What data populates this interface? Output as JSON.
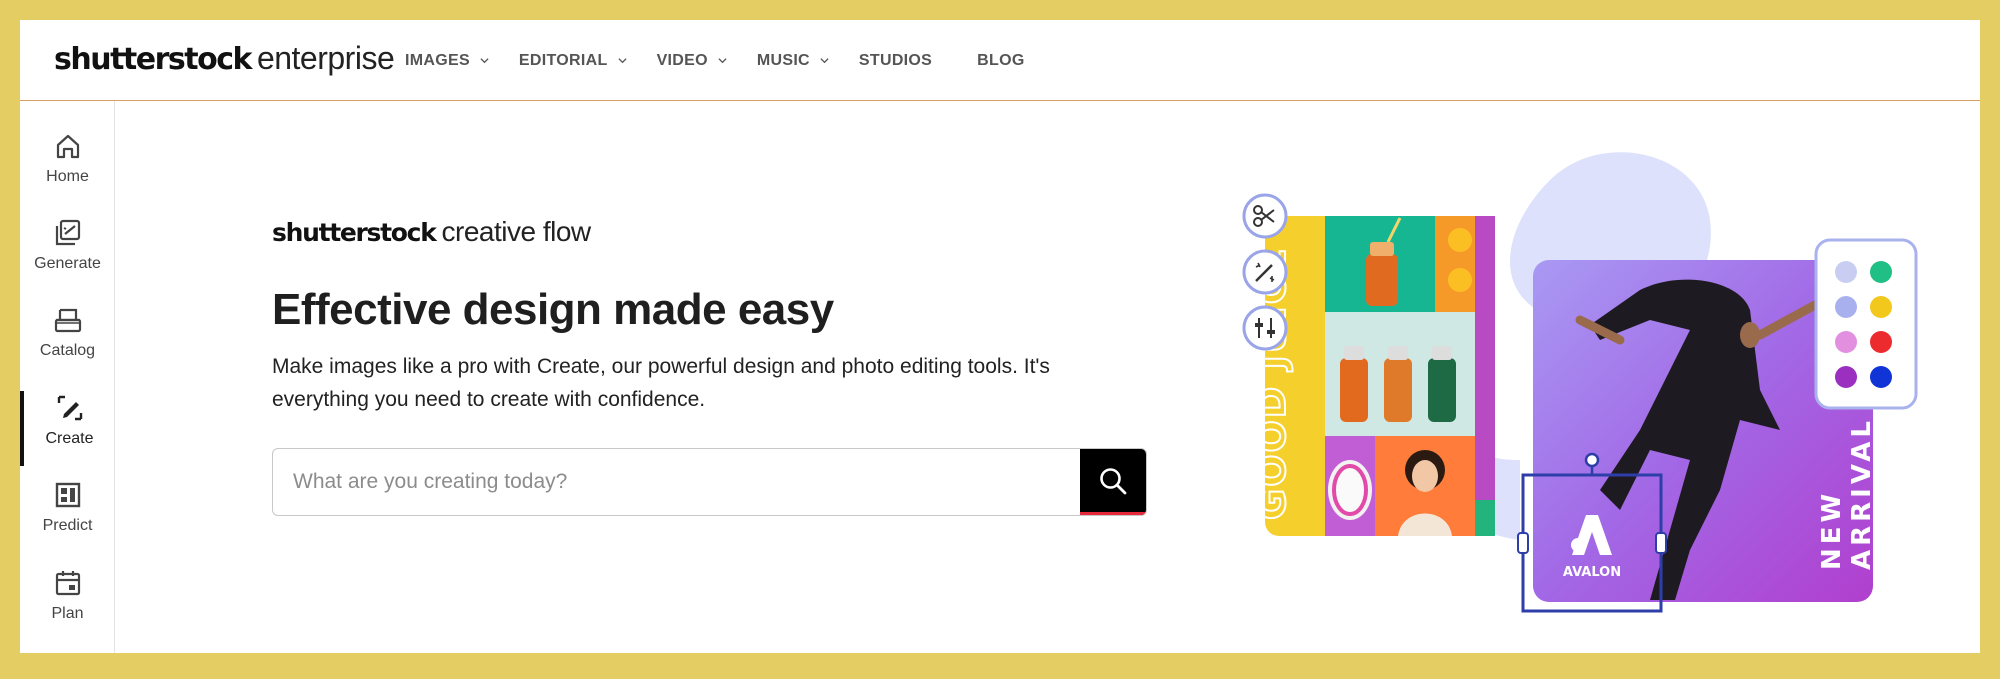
{
  "header": {
    "logo_brand": "shutterstock",
    "logo_suffix": "enterprise",
    "nav": [
      {
        "label": "IMAGES",
        "has_dropdown": true
      },
      {
        "label": "EDITORIAL",
        "has_dropdown": true
      },
      {
        "label": "VIDEO",
        "has_dropdown": true
      },
      {
        "label": "MUSIC",
        "has_dropdown": true
      },
      {
        "label": "STUDIOS",
        "has_dropdown": false
      },
      {
        "label": "BLOG",
        "has_dropdown": false
      }
    ]
  },
  "sidebar": {
    "items": [
      {
        "label": "Home",
        "icon": "home-icon"
      },
      {
        "label": "Generate",
        "icon": "generate-icon"
      },
      {
        "label": "Catalog",
        "icon": "catalog-icon"
      },
      {
        "label": "Create",
        "icon": "create-icon",
        "active": true
      },
      {
        "label": "Predict",
        "icon": "predict-icon"
      },
      {
        "label": "Plan",
        "icon": "plan-icon"
      }
    ]
  },
  "main": {
    "product_brand": "shutterstock",
    "product_suffix": "creative flow",
    "title": "Effective design made easy",
    "description": "Make images like a pro with Create, our powerful design and photo editing tools. It's everything you need to create with confidence.",
    "search_placeholder": "What are you creating today?"
  },
  "illustration": {
    "left_card_text": "GOOD JUICE",
    "right_card_text_1": "NEW",
    "right_card_text_2": "ARRIVAL",
    "logo_text": "AVALON",
    "swatches": [
      "#c9cdf2",
      "#1fbf86",
      "#a9b0ee",
      "#f2c81d",
      "#e28fe0",
      "#ec2b2f",
      "#9b2fc0",
      "#1134d6"
    ]
  },
  "colors": {
    "frame_border": "#e4cd63",
    "header_divider": "#d9a066",
    "search_accent": "#e8283b"
  }
}
